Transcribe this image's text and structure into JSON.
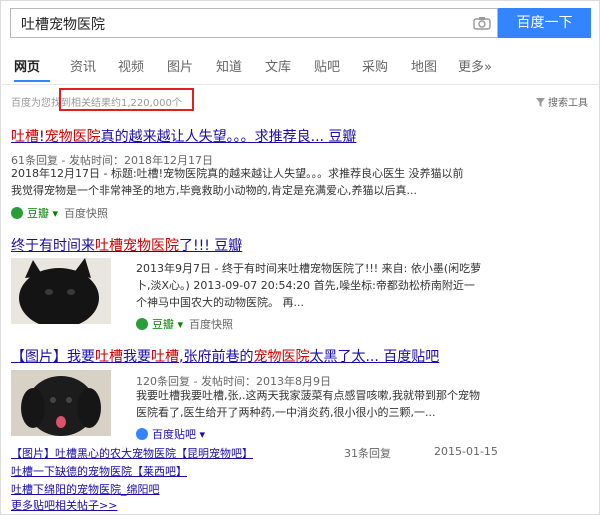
{
  "search": {
    "query": "吐槽宠物医院",
    "button": "百度一下",
    "camera_icon": "camera-icon"
  },
  "tabs": [
    "网页",
    "资讯",
    "视频",
    "图片",
    "知道",
    "文库",
    "贴吧",
    "采购",
    "地图",
    "更多»"
  ],
  "active_tab": "网页",
  "result_count": {
    "prefix": "百度为您找到",
    "text": "相关结果约1,220,000个"
  },
  "tools": "搜索工具",
  "results": [
    {
      "title_parts": [
        "吐槽",
        "!",
        "宠物医院",
        "真的越来越让人失望。。。求推荐良... 豆瓣"
      ],
      "meta": "61条回复 - 发帖时间：2018年12月17日",
      "snippet_1": "2018年12月17日 - 标题:吐槽!宠物医院真的越来越让人失望。。。求推荐良心医生 没养猫以前",
      "snippet_2": "我觉得宠物是一个非常神圣的地方,毕竟救助小动物的,肯定是充满爱心,养猫以后真...",
      "source": "豆瓣",
      "cache": "百度快照"
    },
    {
      "title_parts": [
        "终于有时间来",
        "吐槽宠物医院",
        "了!!! 豆瓣"
      ],
      "snippet_1": "2013年9月7日 - 终于有时间来吐槽宠物医院了!!! 来自: 依小墨(闲吃萝",
      "snippet_2": "卜,淡X心。) 2013-09-07 20:54:20 首先,噪坐标:帝都劲松桥南附近一",
      "snippet_3": "个神马中国农大的动物医院。 再...",
      "source": "豆瓣",
      "cache": "百度快照"
    },
    {
      "title_parts": [
        "【图片】我要",
        "吐槽",
        "我要",
        "吐槽",
        ",张府前巷的",
        "宠物医院",
        "太黑了太... 百度贴吧"
      ],
      "meta": "120条回复 - 发帖时间：2013年8月9日",
      "snippet_1": "我要吐槽我要吐槽,张,.这两天我家菠菜有点感冒咳嗽,我就带到那个宠物",
      "snippet_2": "医院看了,医生给开了两种药,一中消炎药,很小很小的三颗,一...",
      "source": "百度贴吧",
      "sub_rows": [
        {
          "text": "【图片】吐槽黑心的农大宠物医院【昆明宠物吧】",
          "replies": "31条回复",
          "date": "2015-01-15"
        },
        {
          "text": "吐槽一下缺德的宠物医院【莱西吧】"
        },
        {
          "text": "吐槽下绵阳的宠物医院_绵阳吧"
        }
      ],
      "more": "更多贴吧相关帖子>>"
    }
  ],
  "colors": {
    "link": "#1a0dab",
    "highlight": "#cc0000",
    "accent": "#3385ff",
    "source": "#008000",
    "count_box": "#e02020"
  }
}
